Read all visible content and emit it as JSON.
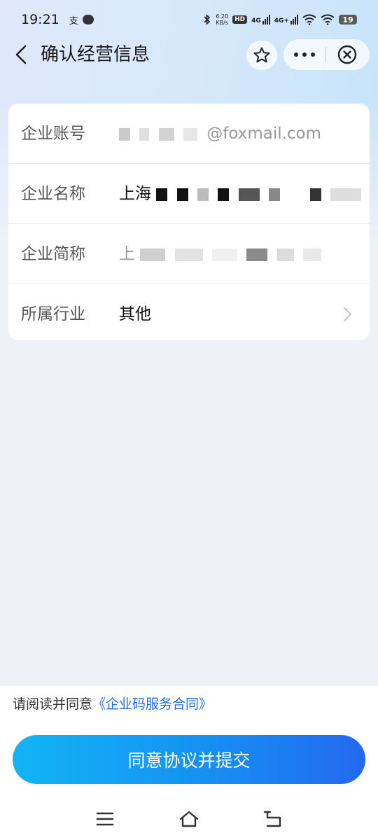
{
  "status_bar": {
    "time": "19:21",
    "left_glyph": "支",
    "net_speed_value": "6.20",
    "net_speed_unit": "KB/s",
    "hd_badge": "HD",
    "sim1_label": "4G",
    "sim2_label": "4G+",
    "battery_level": "19"
  },
  "header": {
    "title": "确认经营信息"
  },
  "form": {
    "account": {
      "label": "企业账号",
      "value_suffix": "@foxmail.com"
    },
    "name": {
      "label": "企业名称",
      "value_prefix": "上海"
    },
    "short_name": {
      "label": "企业简称",
      "value_prefix": "上"
    },
    "industry": {
      "label": "所属行业",
      "value": "其他"
    }
  },
  "footer": {
    "agree_prefix": "请阅读并同意",
    "agree_link": "《企业码服务合同》",
    "submit_label": "同意协议并提交"
  },
  "colors": {
    "accent": "#1e6ee8",
    "button_start": "#12b5f5",
    "button_end": "#2468f0"
  }
}
